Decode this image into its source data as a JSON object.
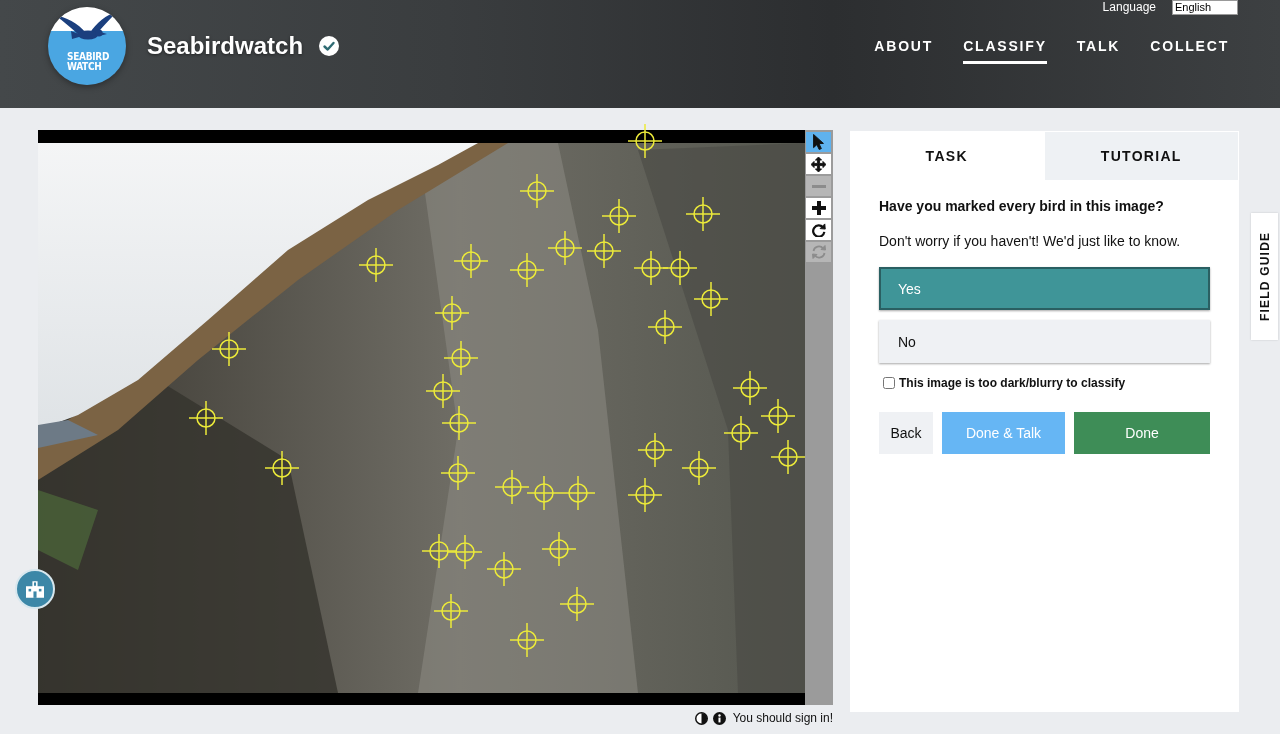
{
  "header": {
    "logo_lines": [
      "SEABIRD",
      "WATCH"
    ],
    "title": "Seabirdwatch",
    "language": {
      "label": "Language",
      "value": "English"
    },
    "nav": [
      {
        "label": "ABOUT",
        "selected": false
      },
      {
        "label": "CLASSIFY",
        "selected": true
      },
      {
        "label": "TALK",
        "selected": false
      },
      {
        "label": "COLLECT",
        "selected": false
      }
    ]
  },
  "viewer": {
    "tools": [
      {
        "kind": "pointer",
        "selected": true,
        "disabled": false
      },
      {
        "kind": "move",
        "selected": false,
        "disabled": false
      },
      {
        "kind": "zoom_out",
        "selected": false,
        "disabled": true
      },
      {
        "kind": "zoom_in",
        "selected": false,
        "disabled": false
      },
      {
        "kind": "rotate",
        "selected": false,
        "disabled": false
      },
      {
        "kind": "reset",
        "selected": false,
        "disabled": true
      }
    ],
    "footer_message": "You should sign in!"
  },
  "task_panel": {
    "tabs": [
      {
        "label": "TASK",
        "selected": true
      },
      {
        "label": "TUTORIAL",
        "selected": false
      }
    ],
    "question": "Have you marked every bird in this image?",
    "help": "Don't worry if you haven't! We'd just like to know.",
    "answers": [
      {
        "label": "Yes",
        "selected": true
      },
      {
        "label": "No",
        "selected": false
      }
    ],
    "flag": {
      "label": "This image is too dark/blurry to classify",
      "checked": false
    },
    "buttons": [
      {
        "kind": "back",
        "label": "Back"
      },
      {
        "kind": "done_talk",
        "label": "Done & Talk"
      },
      {
        "kind": "done",
        "label": "Done"
      }
    ]
  },
  "field_guide": {
    "label": "FIELD GUIDE"
  }
}
